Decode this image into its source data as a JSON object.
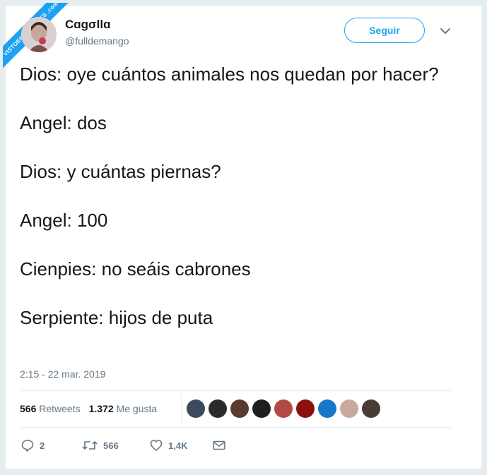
{
  "watermark": {
    "text": "VISTOENLASREDES .com"
  },
  "user": {
    "name": "Cɑgσllɑ",
    "handle": "@fulldemango",
    "follow_label": "Seguir"
  },
  "tweet": {
    "lines": [
      "Dios: oye cuántos animales nos quedan por hacer?",
      "Angel: dos",
      "Dios: y cuántas piernas?",
      "Angel: 100",
      "Cienpies: no seáis cabrones",
      "Serpiente: hijos de puta"
    ],
    "timestamp": "2:15 - 22 mar. 2019"
  },
  "stats": {
    "retweets_count": "566",
    "retweets_label": "Retweets",
    "likes_count": "1.372",
    "likes_label": "Me gusta"
  },
  "likers": {
    "colors": [
      "#3c4b5c",
      "#2b2b2b",
      "#5a3a2e",
      "#1f1f1f",
      "#b04a44",
      "#8c1010",
      "#1877c8",
      "#c9a89e",
      "#4a3b34"
    ]
  },
  "actions": {
    "replies": "2",
    "retweets": "566",
    "likes": "1,4K"
  },
  "colors": {
    "accent": "#1da1f2",
    "text": "#14171a",
    "secondary": "#657786"
  }
}
